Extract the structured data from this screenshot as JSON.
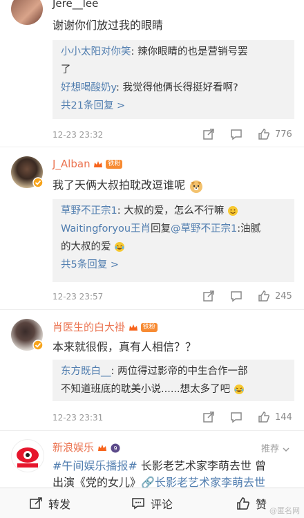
{
  "comments": [
    {
      "username": "Jere__lee",
      "text": "谢谢你们放过我的眼睛",
      "replies": [
        {
          "user": "小小太阳对你笑",
          "text": ": 辣你眼睛的也是营销号罢",
          "cont": "了"
        },
        {
          "user": "好想喝酸奶y",
          "text": ": 我觉得他俩长得挺好看啊?"
        }
      ],
      "more": "共21条回复 >",
      "time": "12-23 23:32",
      "likes": "776"
    },
    {
      "username": "J_Alban",
      "badge": "铁粉",
      "text": "我了天俩大叔拍耽改逗谁呢",
      "replies": [
        {
          "user": "草野不正宗1",
          "text": ": 大叔的爱，怎么不行嘛"
        },
        {
          "user": "Waitingforyou王肖",
          "mid": "回复",
          "user2": "@草野不正宗1",
          "text": ":油腻",
          "cont": "的大叔的爱"
        }
      ],
      "more": "共5条回复 >",
      "time": "12-23 23:57",
      "likes": "245"
    },
    {
      "username": "肖医生的白大褂",
      "badge": "铁粉",
      "text": "本来就很假，真有人相信？？",
      "replies": [
        {
          "user": "东方既白__",
          "text": ": 两位得过影帝的中生合作一部",
          "cont": "不知道班底的耽美小说......想太多了吧"
        }
      ],
      "time": "12-23 23:31",
      "likes": "144"
    },
    {
      "username": "新浪娱乐",
      "tag": "推荐",
      "line1_hashtag": "#午间娱乐播报#",
      "line1_text": " 长影老艺术家李萌去世 曾",
      "line2_text": "出演《党的女儿》",
      "line2_link": "🔗长影老艺术家李萌去世"
    }
  ],
  "bottom_bar": {
    "repost": "转发",
    "comment": "评论",
    "like": "赞"
  },
  "watermark": "@匿名网"
}
